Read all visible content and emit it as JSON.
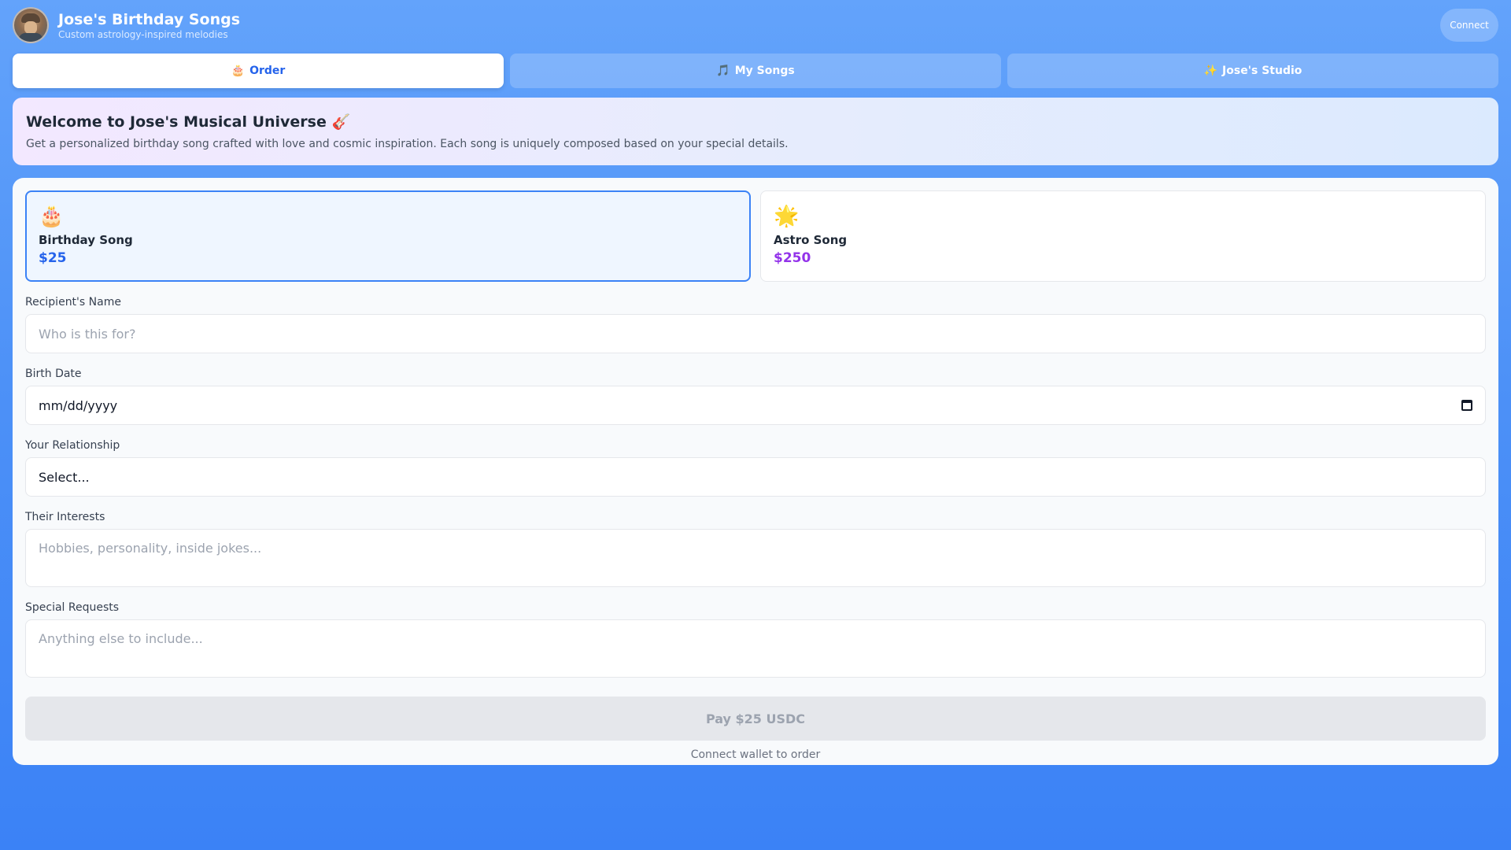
{
  "header": {
    "title": "Jose's Birthday Songs",
    "subtitle": "Custom astrology-inspired melodies",
    "connect_label": "Connect"
  },
  "tabs": [
    {
      "icon": "🎂",
      "label": "Order",
      "active": true
    },
    {
      "icon": "🎵",
      "label": "My Songs",
      "active": false
    },
    {
      "icon": "✨",
      "label": "Jose's Studio",
      "active": false
    }
  ],
  "welcome": {
    "title": "Welcome to Jose's Musical Universe 🎸",
    "text": "Get a personalized birthday song crafted with love and cosmic inspiration. Each song is uniquely composed based on your special details."
  },
  "options": [
    {
      "emoji": "🎂",
      "name": "Birthday Song",
      "price": "$25",
      "selected": true
    },
    {
      "emoji": "🌟",
      "name": "Astro Song",
      "price": "$250",
      "selected": false
    }
  ],
  "form": {
    "name_label": "Recipient's Name",
    "name_placeholder": "Who is this for?",
    "date_label": "Birth Date",
    "date_placeholder": "mm/dd/yyyy",
    "relationship_label": "Your Relationship",
    "relationship_value": "Select...",
    "interests_label": "Their Interests",
    "interests_placeholder": "Hobbies, personality, inside jokes...",
    "requests_label": "Special Requests",
    "requests_placeholder": "Anything else to include...",
    "pay_label": "Pay $25 USDC",
    "pay_note": "Connect wallet to order"
  },
  "colors": {
    "accent": "#2563eb",
    "astro_price": "#9333ea",
    "selected_border": "#3b82f6"
  }
}
